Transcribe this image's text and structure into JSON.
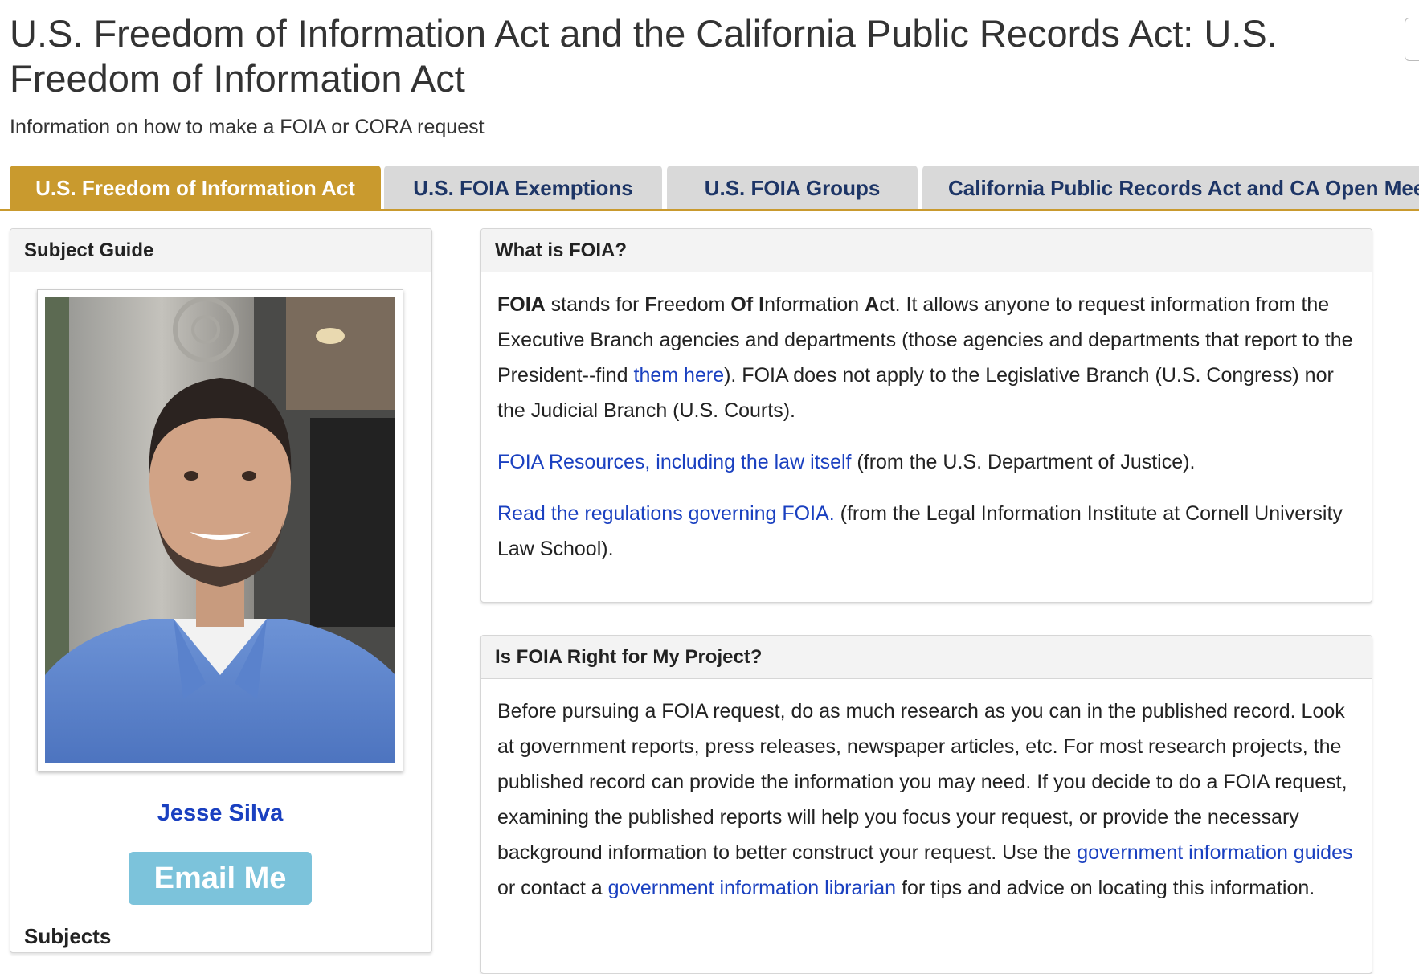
{
  "page": {
    "title": "U.S. Freedom of Information Act and the California Public Records Act: U.S. Freedom of Information Act",
    "subtitle": "Information on how to make a FOIA or CORA request"
  },
  "tabs": [
    {
      "label": "U.S. Freedom of Information Act",
      "active": true
    },
    {
      "label": "U.S. FOIA Exemptions",
      "active": false
    },
    {
      "label": "U.S. FOIA Groups",
      "active": false
    },
    {
      "label": "California Public Records Act and CA Open Meetings",
      "active": false
    }
  ],
  "colors": {
    "tab_active": "#c99a2e",
    "tab_inactive": "#d9d9d9",
    "link": "#1a40c0",
    "email_button": "#7cc3db"
  },
  "sidebar": {
    "heading": "Subject Guide",
    "profile_name": "Jesse Silva",
    "email_label": "Email Me",
    "subjects_label": "Subjects"
  },
  "what_is_foia": {
    "heading": "What is FOIA?",
    "p1": {
      "b1": "FOIA",
      "t1": " stands for ",
      "b2": "F",
      "t2": "reedom ",
      "b3": "Of",
      "t3": " ",
      "b4": "I",
      "t4": "nformation ",
      "b5": "A",
      "t5": "ct.  It allows anyone to request information from the Executive Branch agencies and departments (those agencies and departments that report to the President--find ",
      "link": "them here",
      "t6": ").  FOIA does not apply to the Legislative Branch (U.S. Congress) nor the Judicial Branch (U.S. Courts)."
    },
    "p2": {
      "link": "FOIA Resources, including the law itself",
      "text": " (from the U.S. Department of Justice)."
    },
    "p3": {
      "link": "Read the regulations governing FOIA.",
      "text": " (from the Legal Information Institute at Cornell University Law School)."
    }
  },
  "right_for_project": {
    "heading": "Is FOIA Right for My Project?",
    "p1": {
      "t1": "Before pursuing a FOIA request, do as much research as you can in the published record.  Look at government reports, press releases, newspaper articles, etc.  For most research projects, the published record can provide the information you may need.  If you decide to do a FOIA request, examining the published reports will help you focus your request, or provide the necessary background information to better construct your request. Use the ",
      "link1": "government information guides",
      "t2": " or contact a ",
      "link2": "government information librarian",
      "t3": " for tips and advice on locating this information."
    }
  }
}
